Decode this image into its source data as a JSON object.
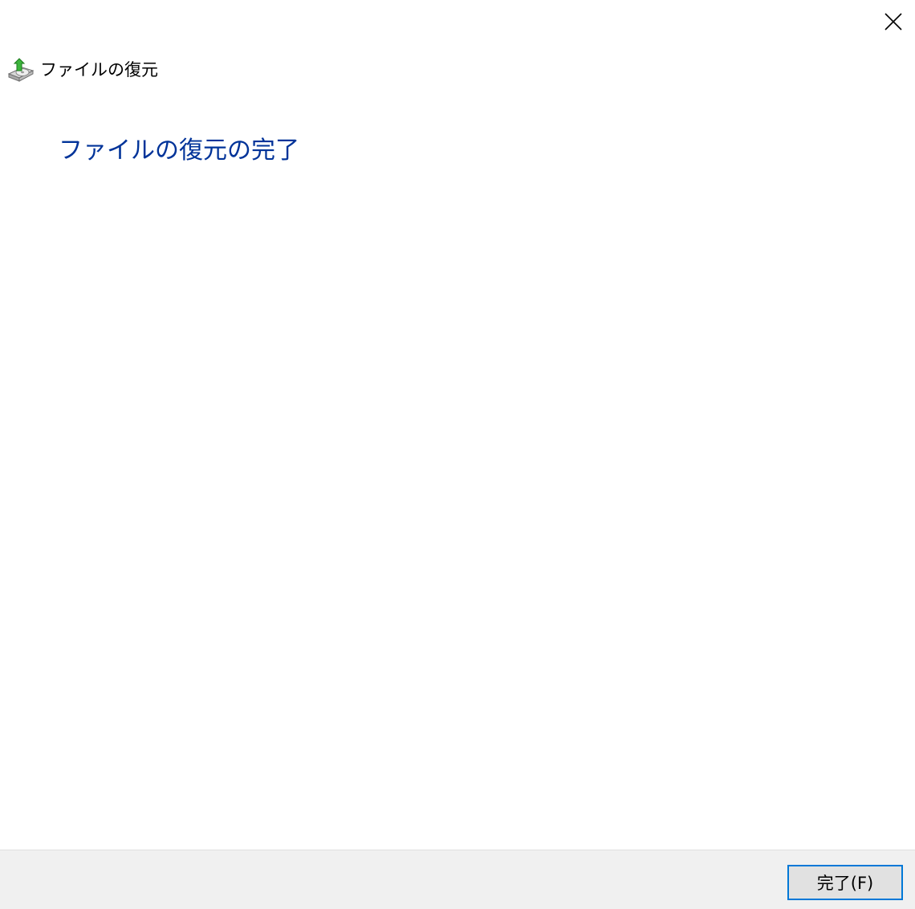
{
  "window": {
    "title": "ファイルの復元",
    "app_icon": "file-restore-icon",
    "close_icon": "close-icon"
  },
  "main": {
    "heading": "ファイルの復元の完了"
  },
  "footer": {
    "finish_label": "完了(F)"
  },
  "colors": {
    "heading": "#003399",
    "footer_background": "#f0f0f0",
    "button_border_focus": "#0078d7",
    "button_background": "#e1e1e1"
  }
}
